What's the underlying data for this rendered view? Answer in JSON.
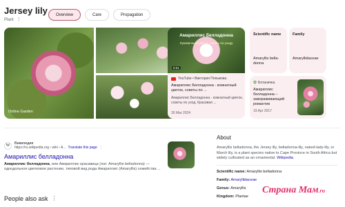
{
  "header": {
    "title": "Jersey lily",
    "subtitle": "Plant",
    "tabs": [
      {
        "label": "Overview",
        "active": true
      },
      {
        "label": "Care",
        "active": false
      },
      {
        "label": "Propagation",
        "active": false
      }
    ]
  },
  "gallery": {
    "main_label": "Online Garden"
  },
  "video": {
    "overlay_title": "Амариллис белладонна",
    "overlay_sub": "Лукoвичный цветок, советы по уходу",
    "time": "5:51",
    "source": "YouTube • Виктория Попыкова",
    "title": "Амариллис Белладонна - комнатный цветок, советы по ...",
    "desc": "Амариллис Белладонна - комнатный цветок, советы по уход. Красивая ...",
    "date": "30 Mar 2024"
  },
  "facts_cards": {
    "scientific_label": "Scientific name",
    "scientific_value": "Amaryllis bella­donna",
    "family_label": "Family",
    "family_value": "Amaryllidaceae"
  },
  "article": {
    "source": "Ботаничка",
    "title": "Амариллис белладонна – завораживающий романтик",
    "date": "19 Apr 2017"
  },
  "result": {
    "site_name": "Википедия",
    "url": "https://ru.wikipedia.org › wiki › A...",
    "translate": "Translate this page",
    "title": "Амариллис белладонна",
    "snippet_bold": "Амариллис белладонна",
    "snippet_rest": ", или Амариллис красавица (лат. Amaryllis belladonna) — однодольное цветковое растение, типовой вид рода Амариллис (Amaryllis) семейства ..."
  },
  "paa": {
    "label": "People also ask"
  },
  "about": {
    "heading": "About",
    "text": "Amaryllis belladonna, the Jersey lily, belladonna-lily, naked-lady-lily, or March lily, is a plant species native to Cape Province in South Africa but widely cultivated as an ornamental. ",
    "link": "Wikipedia",
    "rows": [
      {
        "label": "Scientific name:",
        "value": "Amaryllis belladonna"
      },
      {
        "label": "Family:",
        "value": "Amaryllidaceae"
      },
      {
        "label": "Genus:",
        "value": "Amaryllis"
      },
      {
        "label": "Kingdom:",
        "value": "Plantae"
      }
    ]
  },
  "watermark": {
    "text": "Страна Мам",
    "tld": ".ru"
  },
  "colors": {
    "accent_tab": "#fce8ec",
    "card_bg": "#fbeef1",
    "link": "#1a0dab",
    "watermark": "#e1306c"
  },
  "icons": [
    "more-vert-icon",
    "image-search-icon",
    "youtube-icon",
    "botanichka-icon",
    "wikipedia-icon"
  ]
}
